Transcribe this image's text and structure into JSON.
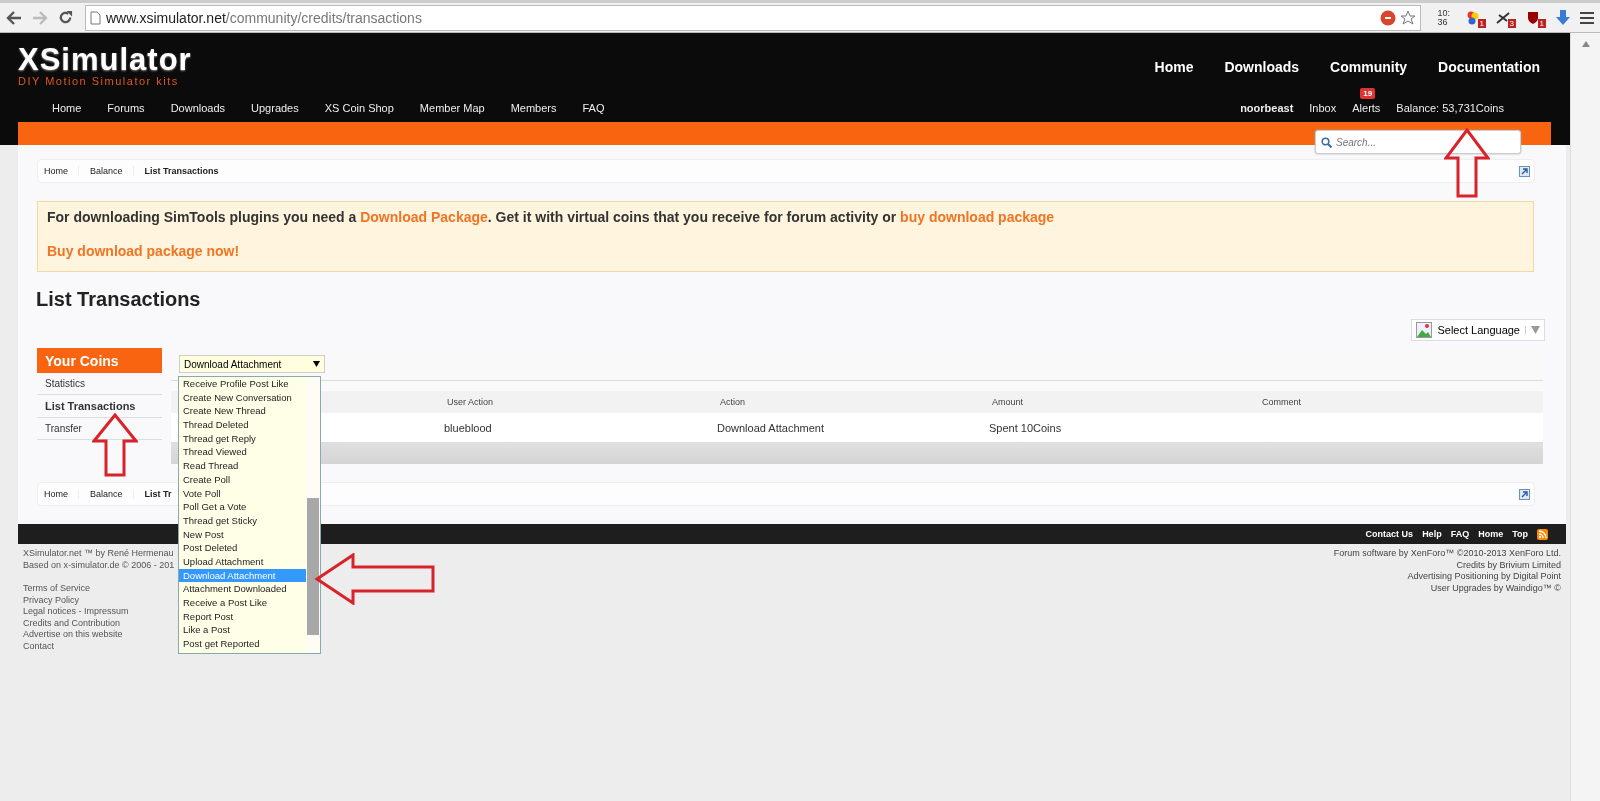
{
  "browser": {
    "url_host": "www.xsimulator.net",
    "url_path": "/community/credits/transactions",
    "clock": [
      "10:",
      "36"
    ],
    "extension_badges": [
      "1",
      "3",
      "1"
    ]
  },
  "header": {
    "logo": "XSimulator",
    "tagline": "DIY Motion Simulator kits",
    "main_nav": [
      "Home",
      "Downloads",
      "Community",
      "Documentation"
    ],
    "sub_nav": [
      "Home",
      "Forums",
      "Downloads",
      "Upgrades",
      "XS Coin Shop",
      "Member Map",
      "Members",
      "FAQ"
    ],
    "user": "noorbeast",
    "inbox": "Inbox",
    "alerts": {
      "label": "Alerts",
      "count": "19"
    },
    "balance": "Balance: 53,731Coins"
  },
  "search": {
    "placeholder": "Search..."
  },
  "breadcrumb": [
    "Home",
    "Balance",
    "List Transactions"
  ],
  "breadcrumb_bottom": [
    "Home",
    "Balance",
    "List Tr"
  ],
  "notice": {
    "sentence": [
      {
        "kind": "text",
        "text": "For downloading SimTools plugins you need a "
      },
      {
        "kind": "link",
        "text": "Download Package"
      },
      {
        "kind": "text",
        "text": ". Get it with virtual coins that you receive for forum activity or "
      },
      {
        "kind": "link",
        "text": "buy download package"
      }
    ],
    "cta": "Buy download package now!"
  },
  "title": "List Transactions",
  "language": {
    "label": "Select Language"
  },
  "sidebar": {
    "heading": "Your Coins",
    "items": [
      {
        "label": "Statistics",
        "selected": false
      },
      {
        "label": "List Transactions",
        "selected": true
      },
      {
        "label": "Transfer",
        "selected": false
      }
    ]
  },
  "filter": {
    "value": "Download Attachment",
    "options": [
      {
        "label": "Receive Profile Post Like",
        "selected": false
      },
      {
        "label": "Create New Conversation",
        "selected": false
      },
      {
        "label": "Create New Thread",
        "selected": false
      },
      {
        "label": "Thread Deleted",
        "selected": false
      },
      {
        "label": "Thread get Reply",
        "selected": false
      },
      {
        "label": "Thread Viewed",
        "selected": false
      },
      {
        "label": "Read Thread",
        "selected": false
      },
      {
        "label": "Create Poll",
        "selected": false
      },
      {
        "label": "Vote Poll",
        "selected": false
      },
      {
        "label": "Poll Get a Vote",
        "selected": false
      },
      {
        "label": "Thread get Sticky",
        "selected": false
      },
      {
        "label": "New Post",
        "selected": false
      },
      {
        "label": "Post Deleted",
        "selected": false
      },
      {
        "label": "Upload Attachment",
        "selected": false
      },
      {
        "label": "Download Attachment",
        "selected": true
      },
      {
        "label": "Attachment Downloaded",
        "selected": false
      },
      {
        "label": "Receive a Post Like",
        "selected": false
      },
      {
        "label": "Report Post",
        "selected": false
      },
      {
        "label": "Like a Post",
        "selected": false
      },
      {
        "label": "Post get Reported",
        "selected": false
      }
    ]
  },
  "table": {
    "columns": [
      "",
      "User Action",
      "Action",
      "Amount",
      "Comment"
    ],
    "rows": [
      [
        "",
        "blueblood",
        "Download Attachment",
        "Spent 10Coins",
        ""
      ]
    ]
  },
  "footer": {
    "links": [
      "Contact Us",
      "Help",
      "FAQ",
      "Home",
      "Top"
    ],
    "left_lines": [
      "XSimulator.net ™ by René Hermenau",
      "Based on x-simulator.de © 2006 - 201"
    ],
    "left_links": [
      "Terms of Service",
      "Privacy Policy",
      "Legal notices - Impressum",
      "Credits and Contribution",
      "Advertise on this website",
      "Contact"
    ],
    "right_lines": [
      "Forum software by XenForo™ ©2010-2013 XenForo Ltd.",
      "Credits by Brivium Limited",
      "Advertising Positioning by Digital Point",
      "User Upgrades by Waindigo™ ©"
    ]
  }
}
